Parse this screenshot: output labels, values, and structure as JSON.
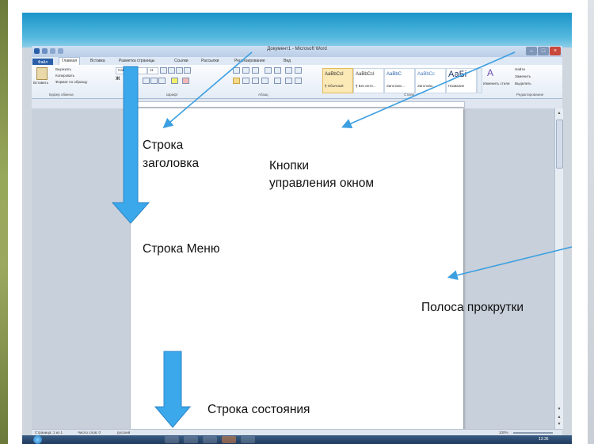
{
  "window": {
    "title": "Документ1 - Microsoft Word"
  },
  "ribbon_tabs": [
    "Файл",
    "Главная",
    "Вставка",
    "Разметка страницы",
    "Ссылки",
    "Рассылки",
    "Рецензирование",
    "Вид"
  ],
  "clipboard": {
    "paste_label": "Вставить",
    "cut_label": "Вырезать",
    "copy_label": "Копировать",
    "format_label": "Формат по образцу",
    "group_label": "Буфер обмена"
  },
  "font_group": {
    "font_name": "Calibri",
    "font_size": "11",
    "group_label": "Шрифт"
  },
  "paragraph_group": {
    "group_label": "Абзац"
  },
  "styles": {
    "items": [
      {
        "sample": "AaBbCcI",
        "name": "¶ Обычный"
      },
      {
        "sample": "AaBbCcI",
        "name": "¶ Без инте..."
      },
      {
        "sample": "AaBbC",
        "name": "Заголово..."
      },
      {
        "sample": "AaBbCc",
        "name": "Заголово..."
      },
      {
        "sample": "АаБі",
        "name": "Название"
      }
    ],
    "change_styles": "Изменить стили",
    "group_label": "Стили"
  },
  "editing": {
    "find": "Найти",
    "replace": "Заменить",
    "select": "Выделить",
    "group_label": "Редактирование"
  },
  "statusbar": {
    "page": "Страница: 1 из 1",
    "words": "Число слов: 0",
    "language": "русский",
    "zoom": "100%"
  },
  "clock": "13:36",
  "annotations": {
    "title_bar_line1": "Строка",
    "title_bar_line2": "заголовка",
    "window_buttons_line1": "Кнопки",
    "window_buttons_line2": "управления окном",
    "menu_bar": "Строка Меню",
    "scrollbar": "Полоса прокрутки",
    "status_bar": "Строка состояния"
  },
  "colors": {
    "arrow_blue": "#3aa8ea",
    "line_blue": "#3b9fe0",
    "ribbon_tab_file": "#2a5fa8"
  }
}
